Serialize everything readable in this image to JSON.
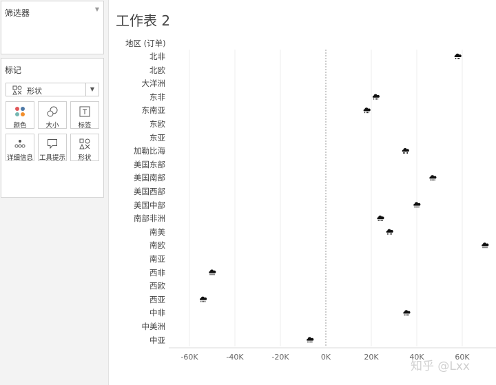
{
  "sidebar": {
    "filters_title": "筛选器",
    "marks_title": "标记",
    "mark_type": "形状",
    "buttons": [
      "颜色",
      "大小",
      "标签",
      "详细信息",
      "工具提示",
      "形状"
    ]
  },
  "sheet": {
    "title": "工作表 2",
    "row_header": "地区 (订单)"
  },
  "watermark": "知乎 @Lxx",
  "chart_data": {
    "type": "scatter",
    "categories": [
      "北非",
      "北欧",
      "大洋洲",
      "东非",
      "东南亚",
      "东欧",
      "东亚",
      "加勒比海",
      "美国东部",
      "美国南部",
      "美国西部",
      "美国中部",
      "南部非洲",
      "南美",
      "南欧",
      "南亚",
      "西非",
      "西欧",
      "西亚",
      "中非",
      "中美洲",
      "中亚"
    ],
    "values": [
      58000,
      null,
      null,
      22000,
      18000,
      null,
      null,
      35000,
      null,
      47000,
      null,
      40000,
      24000,
      28000,
      70000,
      null,
      -50000,
      null,
      -54000,
      35500,
      null,
      -7000
    ],
    "xlim": [
      -70000,
      75000
    ],
    "x_ticks": [
      -60000,
      -40000,
      -20000,
      0,
      20000,
      40000,
      60000
    ],
    "x_tick_labels": [
      "-60K",
      "-40K",
      "-20K",
      "0K",
      "20K",
      "40K",
      "60K"
    ],
    "grid": true,
    "marker": "cloud-rain-icon"
  }
}
